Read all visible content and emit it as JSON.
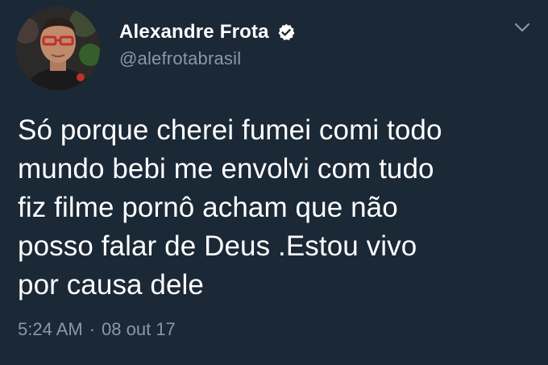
{
  "author": {
    "display_name": "Alexandre Frota",
    "handle": "@alefrotabrasil",
    "verified": true,
    "avatar_icon": "profile-photo",
    "verified_icon": "verified-badge-icon"
  },
  "tweet": {
    "text": "Só porque cherei fumei comi todo\nmundo bebi me envolvi com tudo\nfiz filme pornô acham que não\nposso falar de Deus .Estou vivo\npor causa dele",
    "time": "5:24 AM",
    "separator": "·",
    "date": "08 out 17"
  },
  "menu": {
    "icon": "chevron-down-icon"
  },
  "colors": {
    "background": "#1b2836",
    "primary_text": "#ffffff",
    "secondary_text": "#8899a6",
    "verified_badge": "#ffffff"
  }
}
